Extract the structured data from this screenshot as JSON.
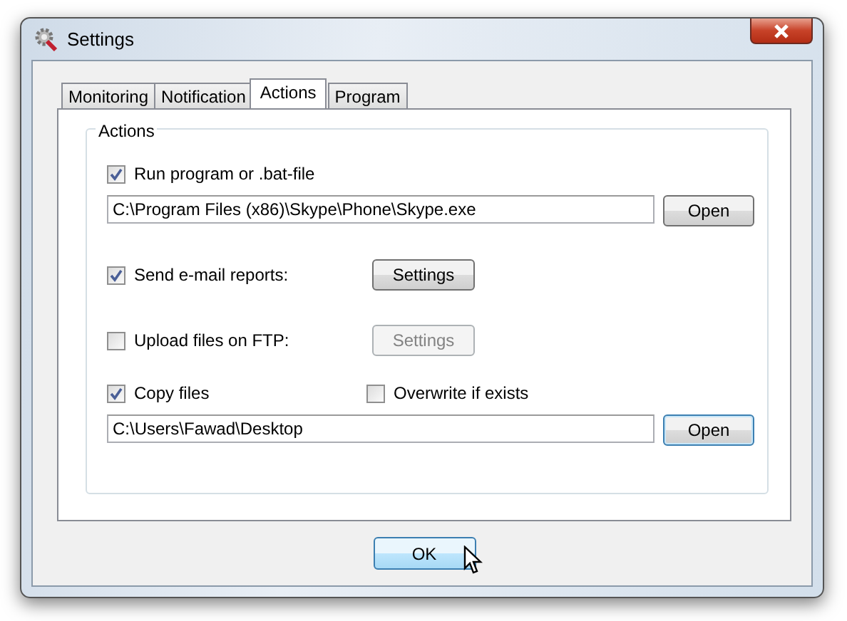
{
  "window": {
    "title": "Settings"
  },
  "tabs": [
    {
      "label": "Monitoring",
      "selected": false
    },
    {
      "label": "Notification",
      "selected": false
    },
    {
      "label": "Actions",
      "selected": true
    },
    {
      "label": "Program",
      "selected": false
    }
  ],
  "group": {
    "title": "Actions"
  },
  "rows": [
    {
      "kind": "check",
      "label": "Run program or .bat-file",
      "checked": true
    },
    {
      "kind": "path",
      "value": "C:\\Program Files (x86)\\Skype\\Phone\\Skype.exe",
      "button": "Open",
      "focused": false
    },
    {
      "kind": "check-button",
      "label": "Send e-mail reports:",
      "checked": true,
      "button": "Settings",
      "disabled": false
    },
    {
      "kind": "check-button",
      "label": "Upload files on FTP:",
      "checked": false,
      "button": "Settings",
      "disabled": true
    },
    {
      "kind": "check-pair",
      "label": "Copy files",
      "checked": true,
      "label_2": "Overwrite if exists",
      "checked_2": false
    },
    {
      "kind": "path",
      "value": "C:\\Users\\Fawad\\Desktop",
      "button": "Open",
      "focused": true
    }
  ],
  "ok_button": "OK"
}
